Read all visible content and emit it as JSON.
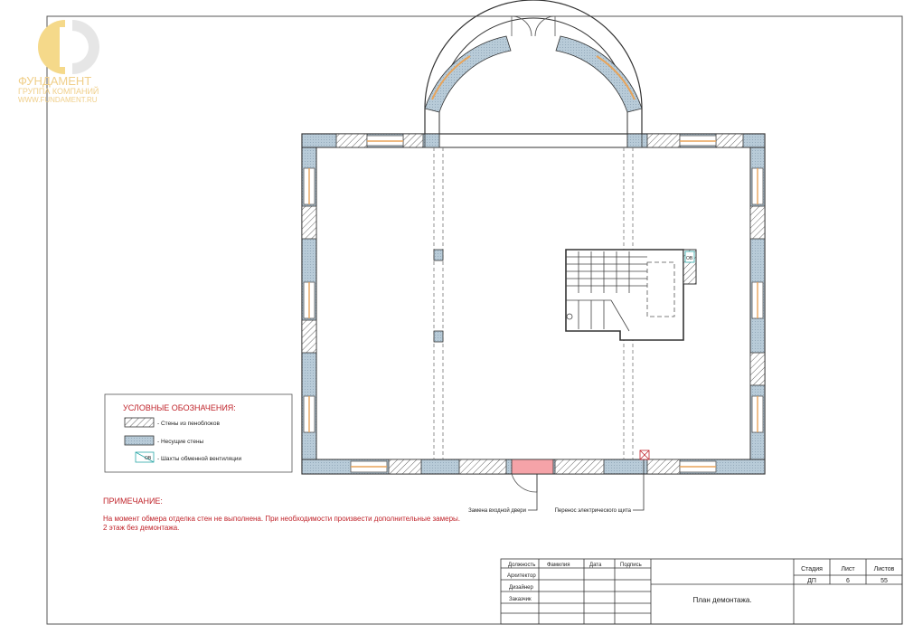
{
  "watermark": {
    "company_name": "ФУНДАМЕНТ",
    "company_sub": "ГРУППА КОМПАНИЙ",
    "site": "WWW.FUNDAMENT.RU"
  },
  "legend": {
    "title": "УСЛОВНЫЕ ОБОЗНАЧЕНИЯ:",
    "items": [
      {
        "label": "- Стены из пеноблоков"
      },
      {
        "label": "- Несущие стены"
      },
      {
        "label": "- Шахты обменной вентиляции"
      }
    ],
    "vent_code": "ОВ"
  },
  "note": {
    "title": "ПРИМЕЧАНИЕ:",
    "line1": "На момент обмера отделка стен не выполнена. При необходимости произвести дополнительные замеры.",
    "line2": "2 этаж без демонтажа."
  },
  "callouts": {
    "door": "Замена входной двери",
    "panel": "Перенос электрического щита"
  },
  "plan": {
    "vent_code": "ОВ"
  },
  "title_block": {
    "headers": {
      "position": "Должность",
      "surname": "Фамилия",
      "date": "Дата",
      "signature": "Подпись"
    },
    "roles": [
      "Архитектор",
      "Дизайнер",
      "Заказчик"
    ],
    "sheet_title": "План демонтажа.",
    "stage_label": "Стадия",
    "sheet_label": "Лист",
    "sheets_label": "Листов",
    "stage_value": "ДП",
    "sheet_value": "6",
    "sheets_value": "55"
  },
  "colors": {
    "wall_block": "#b8cbd8",
    "door_replace": "#f5a3a8",
    "accent_red": "#c0242b"
  }
}
